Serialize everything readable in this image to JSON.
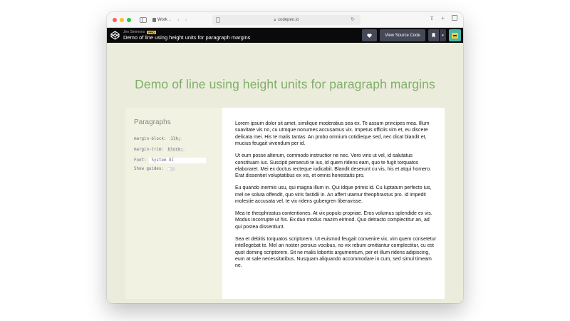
{
  "browser": {
    "profile_label": "Work",
    "address": "codepen.io"
  },
  "codepen": {
    "author": "Jen Simmons",
    "pro_badge": "PRO",
    "title": "Demo of line using height units for paragraph margins",
    "view_source_label": "View Source Code"
  },
  "page": {
    "heading": "Demo of line using height units for paragraph margins",
    "controls": {
      "title": "Paragraphs",
      "margin_block_label": "margin-block:",
      "margin_block_value": "1lh;",
      "margin_trim_label": "margin-trim:",
      "margin_trim_value": "block;",
      "font_label": "Font:",
      "font_value": "System UI",
      "show_guides_label": "Show guides:"
    },
    "paragraphs": [
      "Lorem ipsum dolor sit amet, similique moderatius sea ex. Te assum principes mea. Illum suavitate vis no, cu utroque nonumes accusamus vix. Impetus officiis vim et, eu discere delicata mei. His te malis tantas. An probo omnium cotidieque sed, nec dicat blandit et, mucius feugait vivendum per id.",
      "Ut eum posse alterum, commodo instructior ne nec. Vero viris ut vel, id salutatus constituam ius. Suscipit persecuti te ius, id quem ridens eam, quo te fugit torquatos elaboraret. Mei ex doctus recteque iudicabit. Blandit deserunt cu vis, his et atqui homero. Erat dissentiet voluptatibus ex vis, et omnis honestatis pro.",
      "Eu quando inermis usu, qui magna illum in. Qui idque primis id. Cu luptatum perfecto ius, mel ne soluta offendit, quo viris fastidii in. An affert utamur theophrastus pro. Id impedit molestie accusata vel, te vix ridens gubergren liberavisse.",
      "Mea te theophrastus contentiones. At vix populo propriae. Eros volumus splendide ex vis. Modus incorrupte ut his. Ex duo modus mazim eirmod. Quo detracto complectitur an, ad qui postea dissentiunt.",
      "Sea et debitis torquatos scriptorem. Ut euismod feugait convenire vix, vim quem consetetur intellegebat te. Mel an noster persius vocibus, no vix rebum omittantur complectitur, cu est quot doming scriptorem. Sit ne malis lobortis argumentum, per et illum ridens adipiscing, eum at sale necessitatibus. Nusquam aliquando accommodare in cum, sed simul timeam ne."
    ]
  },
  "colors": {
    "heading_green": "#7fb06a",
    "page_bg": "#ececdc",
    "controls_bg": "#f2f2e3",
    "header_bg": "#0a0a0a",
    "button_bg": "#444857"
  }
}
